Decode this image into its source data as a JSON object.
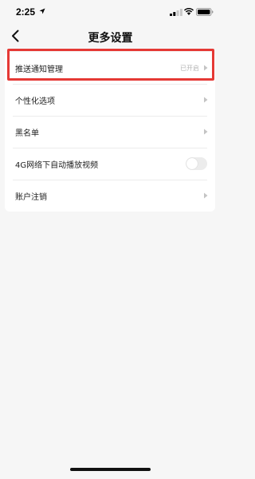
{
  "status_bar": {
    "time": "2:25"
  },
  "nav": {
    "title": "更多设置"
  },
  "settings": {
    "items": [
      {
        "label": "推送通知管理",
        "status": "已开启"
      },
      {
        "label": "个性化选项"
      },
      {
        "label": "黑名单"
      },
      {
        "label": "4G网络下自动播放视频",
        "toggle": false
      },
      {
        "label": "账户注销"
      }
    ]
  },
  "colors": {
    "highlight": "#e53935",
    "background": "#f6f6f6",
    "card": "#ffffff"
  }
}
